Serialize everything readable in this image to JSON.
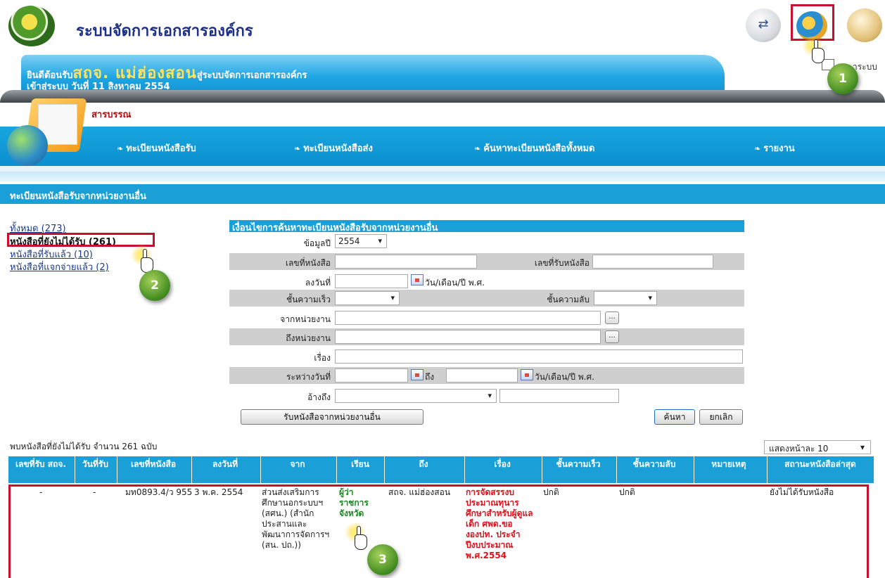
{
  "header": {
    "app_title": "ระบบจัดการเอกสารองค์กร",
    "partial_link": "าระบบ"
  },
  "welcome": {
    "prefix": "ยินดีต้อนรับ",
    "org_name": "สถจ. แม่ฮ่องสอน",
    "suffix": "สู่ระบบจัดการเอกสารองค์กร",
    "login_line": "เข้าสู่ระบบ วันที่ 11 สิงหาคม 2554"
  },
  "menu": {
    "title": "สารบรรณ",
    "items": [
      "ทะเบียนหนังสือรับ",
      "ทะเบียนหนังสือส่ง",
      "ค้นหาทะเบียนหนังสือทั้งหมด",
      "รายงาน"
    ]
  },
  "section_title": "ทะเบียนหนังสือรับจากหน่วยงานอื่น",
  "filters": [
    "ทั้งหมด (273)",
    "หนังสือที่ยังไม่ได้รับ (261)",
    "หนังสือที่รับแล้ว (10)",
    "หนังสือที่แจกจ่ายแล้ว (2)"
  ],
  "search": {
    "heading": "เงื่อนไขการค้นหาทะเบียนหนังสือรับจากหน่วยงานอื่น",
    "year_label": "ข้อมูลปี",
    "year_value": "2554",
    "doc_no_label": "เลขที่หนังสือ",
    "recv_no_label": "เลขที่รับหนังสือ",
    "date_label": "ลงวันที่",
    "date_hint": "วัน/เดือน/ปี พ.ศ.",
    "urgency_label": "ชั้นความเร็ว",
    "secrecy_label": "ชั้นความลับ",
    "from_label": "จากหน่วยงาน",
    "to_label": "ถึงหน่วยงาน",
    "subject_label": "เรื่อง",
    "between_label": "ระหว่างวันที่",
    "to_word": "ถึง",
    "ref_label": "อ้างถึง",
    "receive_button": "รับหนังสือจากหน่วยงานอื่น",
    "search_button": "ค้นหา",
    "cancel_button": "ยกเลิก",
    "more_button": "..."
  },
  "results": {
    "summary": "พบหนังสือที่ยังไม่ได้รับ จำนวน 261 ฉบับ",
    "per_page": "แสดงหน้าละ 10",
    "columns": [
      "เลขที่รับ สถจ.",
      "วันที่รับ",
      "เลขที่หนังสือ",
      "ลงวันที่",
      "จาก",
      "เรียน",
      "ถึง",
      "เรื่อง",
      "ชั้นความเร็ว",
      "ชั้นความลับ",
      "หมายเหตุ",
      "สถานะหนังสือล่าสุด"
    ],
    "rows": [
      {
        "recv_no": "-",
        "recv_date": "-",
        "doc_no": "มท0893.4/ว 955",
        "doc_date": "3 พ.ค. 2554",
        "from": "ส่วนส่งเสริมการศึกษานอกระบบฯ (สศน.) (สำนักประสานและพัฒนาการจัดการฯ (สน. ปถ.))",
        "to_person": "ผู้ว่าราชการจังหวัด",
        "to_org": "สถจ. แม่ฮ่องสอน",
        "subject": "การจัดสรรงบประมาณทุนารศึกษาสำหรับผู้ดูแลเด็ก ศพด.ขององปท. ประจำปีงบประมาณ พ.ศ.2554",
        "urgency": "ปกติ",
        "secrecy": "ปกติ",
        "note": "",
        "status": "ยังไม่ได้รับหนังสือ"
      }
    ]
  },
  "steps": [
    "1",
    "2",
    "3"
  ]
}
